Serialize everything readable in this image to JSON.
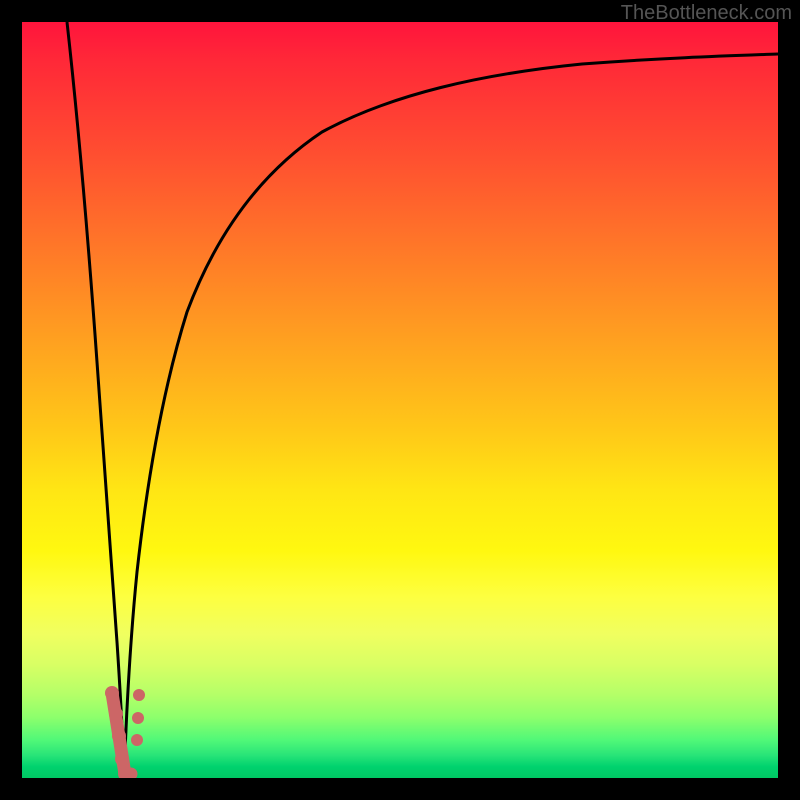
{
  "watermark": "TheBottleneck.com",
  "chart_data": {
    "type": "line",
    "title": "",
    "xlabel": "",
    "ylabel": "",
    "xlim": [
      0,
      100
    ],
    "ylim": [
      0,
      100
    ],
    "background_gradient": {
      "orientation": "vertical",
      "stops": [
        {
          "pos": 0,
          "color": "#ff143c"
        },
        {
          "pos": 0.5,
          "color": "#ffc818"
        },
        {
          "pos": 0.75,
          "color": "#ffff20"
        },
        {
          "pos": 1.0,
          "color": "#00c864"
        }
      ]
    },
    "series": [
      {
        "name": "left-descending-curve",
        "color": "#000000",
        "x": [
          6,
          8,
          10,
          12,
          13.2,
          13.5
        ],
        "y": [
          100,
          75,
          45,
          18,
          4,
          0
        ]
      },
      {
        "name": "right-ascending-curve",
        "color": "#000000",
        "x": [
          13.5,
          14,
          15,
          17,
          20,
          25,
          32,
          42,
          55,
          70,
          85,
          100
        ],
        "y": [
          0,
          8,
          22,
          40,
          55,
          67,
          76,
          83,
          88,
          91.5,
          93.5,
          95
        ]
      },
      {
        "name": "data-points",
        "color": "#cc6666",
        "type": "scatter",
        "x": [
          11.9,
          12.4,
          12.8,
          13.2,
          13.6,
          15.2,
          15.3,
          15.4
        ],
        "y": [
          11.3,
          8.5,
          5.5,
          2.5,
          0.5,
          5.0,
          8.0,
          11.0
        ]
      }
    ]
  }
}
